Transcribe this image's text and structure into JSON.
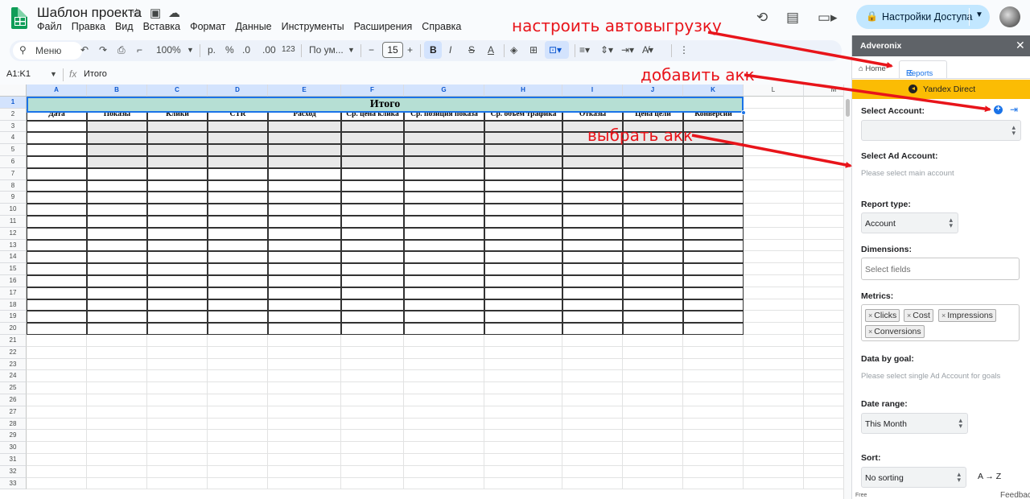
{
  "app": {
    "doc_title": "Шаблон проекта",
    "menu": [
      "Файл",
      "Правка",
      "Вид",
      "Вставка",
      "Формат",
      "Данные",
      "Инструменты",
      "Расширения",
      "Справка"
    ],
    "share_label": "Настройки Доступа"
  },
  "toolbar": {
    "search_label": "Меню",
    "zoom": "100%",
    "currency": "р.",
    "percent": "%",
    "decimal_dec": ".0",
    "decimal_inc": ".00",
    "number_format": "123",
    "font_name": "По ум...",
    "font_size": "15",
    "bold": "B",
    "italic": "I",
    "strike": "S",
    "text_color": "A",
    "more": "⋮"
  },
  "formula_bar": {
    "name_box": "A1:K1",
    "value": "Итого"
  },
  "sheet": {
    "columns": [
      "A",
      "B",
      "C",
      "D",
      "E",
      "F",
      "G",
      "H",
      "I",
      "J",
      "K",
      "L",
      "M"
    ],
    "row_count": 33,
    "merged_title": "Итого",
    "headers": [
      "Дата",
      "Показы",
      "Клики",
      "CTR",
      "Расход",
      "Ср. цена клика",
      "Ср. позиция показа",
      "Ср. объем трафика",
      "Отказы",
      "Цена цели",
      "Конверсии"
    ]
  },
  "panel": {
    "title": "Adveronix",
    "tab_home": "Home",
    "tab_reports": "Reports",
    "platform": "Yandex Direct",
    "select_account_label": "Select Account:",
    "select_ad_account_label": "Select Ad Account:",
    "select_ad_account_hint": "Please select main account",
    "report_type_label": "Report type:",
    "report_type_value": "Account",
    "dimensions_label": "Dimensions:",
    "dimensions_placeholder": "Select fields",
    "metrics_label": "Metrics:",
    "metrics": [
      "Clicks",
      "Cost",
      "Impressions",
      "Conversions"
    ],
    "data_by_goal_label": "Data by goal:",
    "data_by_goal_hint": "Please select single Ad Account for goals",
    "date_range_label": "Date range:",
    "date_range_value": "This Month",
    "sort_label": "Sort:",
    "sort_value": "No sorting",
    "sort_order": "A → Z",
    "footer_left": "Free",
    "footer_right": "Feedback"
  },
  "annotations": {
    "autoexport": "настроить автовыгрузку",
    "add_account": "добавить акк",
    "choose_account": "выбрать акк",
    "color": "#e8141a"
  }
}
